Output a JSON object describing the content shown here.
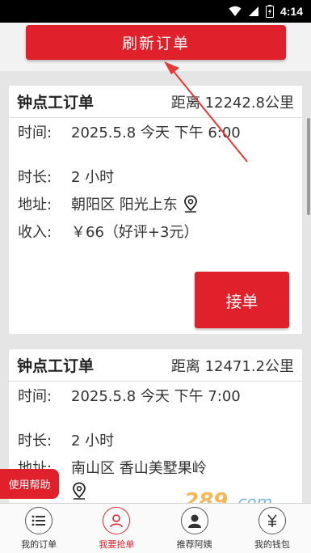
{
  "status_bar": {
    "time": "4:14"
  },
  "refresh": {
    "label": "刷新订单"
  },
  "orders": [
    {
      "title": "钟点工订单",
      "distance": "距离 12242.8公里",
      "time_label": "时间:",
      "time_value": "2025.5.8 今天 下午 6:00",
      "duration_label": "时长:",
      "duration_value": "2 小时",
      "address_label": "地址:",
      "address_value": "朝阳区 阳光上东",
      "income_label": "收入:",
      "income_value": "￥66（好评+3元）",
      "accept_label": "接单"
    },
    {
      "title": "钟点工订单",
      "distance": "距离 12471.2公里",
      "time_label": "时间:",
      "time_value": "2025.5.8 今天 下午 7:00",
      "duration_label": "时长:",
      "duration_value": "2 小时",
      "address_label": "地址:",
      "address_value": "南山区 香山美墅果岭"
    }
  ],
  "help": {
    "label": "使用帮助"
  },
  "watermark": {
    "text": "289.com"
  },
  "tabs": [
    {
      "label": "我的订单",
      "icon": "list-icon"
    },
    {
      "label": "我要抢单",
      "icon": "person-icon"
    },
    {
      "label": "推荐阿姨",
      "icon": "worker-icon"
    },
    {
      "label": "我的钱包",
      "icon": "wallet-icon"
    }
  ],
  "colors": {
    "accent": "#e0202a",
    "background": "#e5e5e5"
  }
}
